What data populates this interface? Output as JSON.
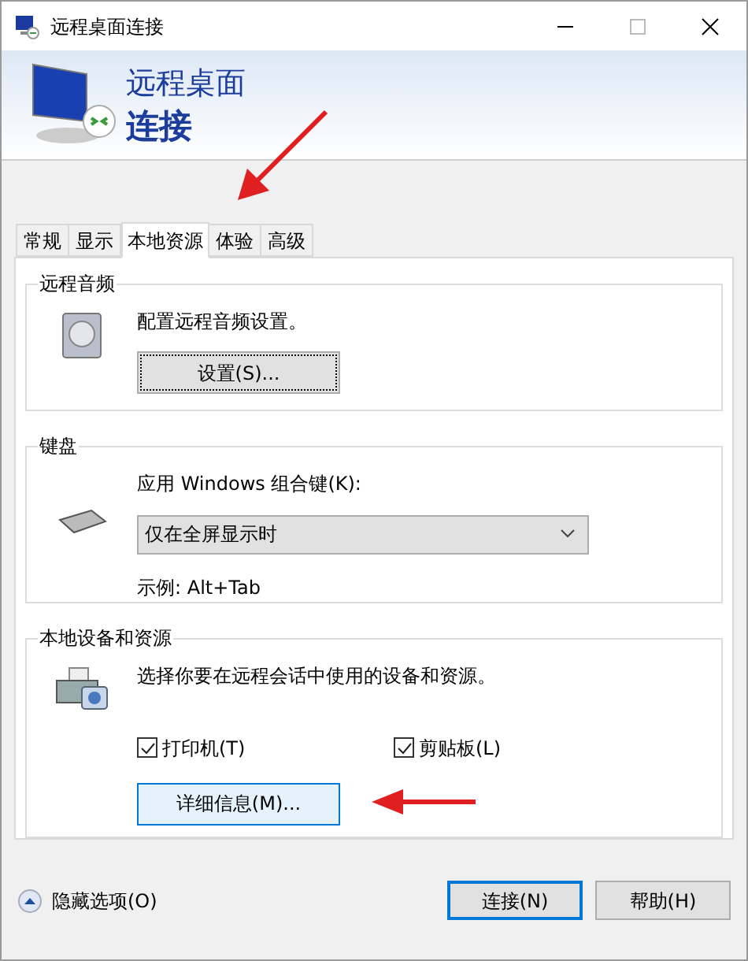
{
  "window": {
    "title": "远程桌面连接"
  },
  "header": {
    "line1": "远程桌面",
    "line2": "连接"
  },
  "tabs": [
    {
      "label": "常规",
      "selected": false
    },
    {
      "label": "显示",
      "selected": false
    },
    {
      "label": "本地资源",
      "selected": true
    },
    {
      "label": "体验",
      "selected": false
    },
    {
      "label": "高级",
      "selected": false
    }
  ],
  "audio": {
    "title": "远程音频",
    "description": "配置远程音频设置。",
    "button": "设置(S)..."
  },
  "keyboard": {
    "title": "键盘",
    "label": "应用 Windows 组合键(K):",
    "select": {
      "value": "仅在全屏显示时"
    },
    "example": "示例: Alt+Tab"
  },
  "devices": {
    "title": "本地设备和资源",
    "description": "选择你要在远程会话中使用的设备和资源。",
    "checkboxes": [
      {
        "label": "打印机(T)",
        "checked": true
      },
      {
        "label": "剪贴板(L)",
        "checked": true
      }
    ],
    "button": "详细信息(M)..."
  },
  "footer": {
    "toggle": "隐藏选项(O)",
    "buttons": [
      {
        "label": "连接(N)",
        "is_default": true
      },
      {
        "label": "帮助(H)",
        "is_default": false
      }
    ]
  }
}
